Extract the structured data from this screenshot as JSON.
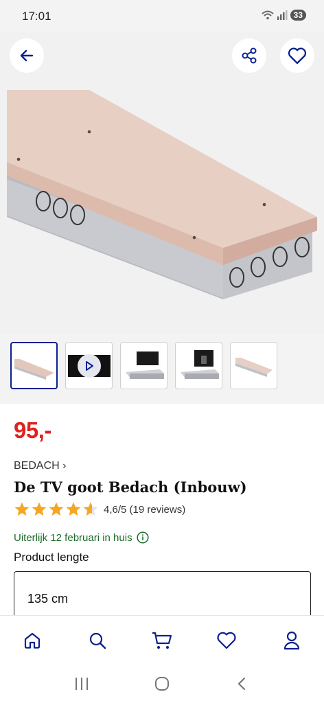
{
  "status_bar": {
    "time": "17:01",
    "battery": "33"
  },
  "product": {
    "price": "95,-",
    "brand": "BEDACH",
    "brand_chevron": "›",
    "title": "De TV goot Bedach (Inbouw)",
    "rating_value": 4.6,
    "rating_text": "4,6/5 (19 reviews)",
    "delivery": "Uiterlijk 12 februari in huis",
    "length_label": "Product lengte",
    "length_value": "135 cm"
  },
  "gallery": {
    "thumbnails": [
      {
        "kind": "image",
        "active": true
      },
      {
        "kind": "video",
        "active": false
      },
      {
        "kind": "image",
        "active": false
      },
      {
        "kind": "image",
        "active": false
      },
      {
        "kind": "image",
        "active": false
      }
    ]
  },
  "bottom_nav": [
    "home-icon",
    "search-icon",
    "cart-icon",
    "heart-icon",
    "user-icon"
  ],
  "colors": {
    "price": "#e0211e",
    "accent": "#0a1f8f",
    "delivery": "#1a6b2b",
    "star": "#f5a623"
  }
}
